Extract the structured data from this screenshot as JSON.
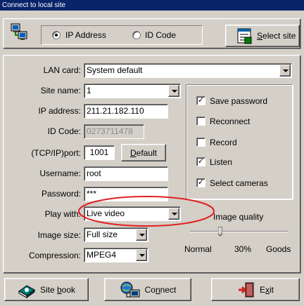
{
  "window": {
    "title": "Connect to local site"
  },
  "mode": {
    "ip_label": "IP Address",
    "id_label": "ID Code",
    "selected": "ip",
    "select_site_label_pre": "",
    "select_site_label_u": "S",
    "select_site_label_post": "elect site"
  },
  "form": {
    "lan_card_label": "LAN card:",
    "lan_card_value": "System default",
    "site_name_label": "Site name:",
    "site_name_value": "1",
    "ip_label": "IP address:",
    "ip_value": "211.21.182.110",
    "id_code_label": "ID Code:",
    "id_code_value": "0273711478",
    "port_label": "(TCP/IP)port:",
    "port_value": "1001",
    "default_u": "D",
    "default_post": "efault",
    "username_label": "Username:",
    "username_value": "root",
    "password_label": "Password:",
    "password_value": "***",
    "play_with_label": "Play with:",
    "play_with_value": "Live video",
    "image_size_label": "Image size:",
    "image_size_value": "Full size",
    "compression_label": "Compression:",
    "compression_value": "MPEG4"
  },
  "options": {
    "save_password": {
      "label": "Save password",
      "checked": true
    },
    "reconnect": {
      "label": "Reconnect",
      "checked": false
    },
    "record": {
      "label": "Record",
      "checked": false
    },
    "listen": {
      "label": "Listen",
      "checked": true
    },
    "select_cameras": {
      "label": "Select cameras",
      "checked": true
    }
  },
  "quality": {
    "title": "Image quality",
    "low_label": "Normal",
    "value_label": "30%",
    "high_label": "Goods",
    "level_percent": 30
  },
  "footer": {
    "site_book_pre": "Site ",
    "site_book_u": "b",
    "site_book_post": "ook",
    "connect_pre": "Co",
    "connect_u": "n",
    "connect_post": "nect",
    "exit_pre": "E",
    "exit_u": "x",
    "exit_post": "it"
  },
  "annotation": {
    "color": "#e02020"
  }
}
